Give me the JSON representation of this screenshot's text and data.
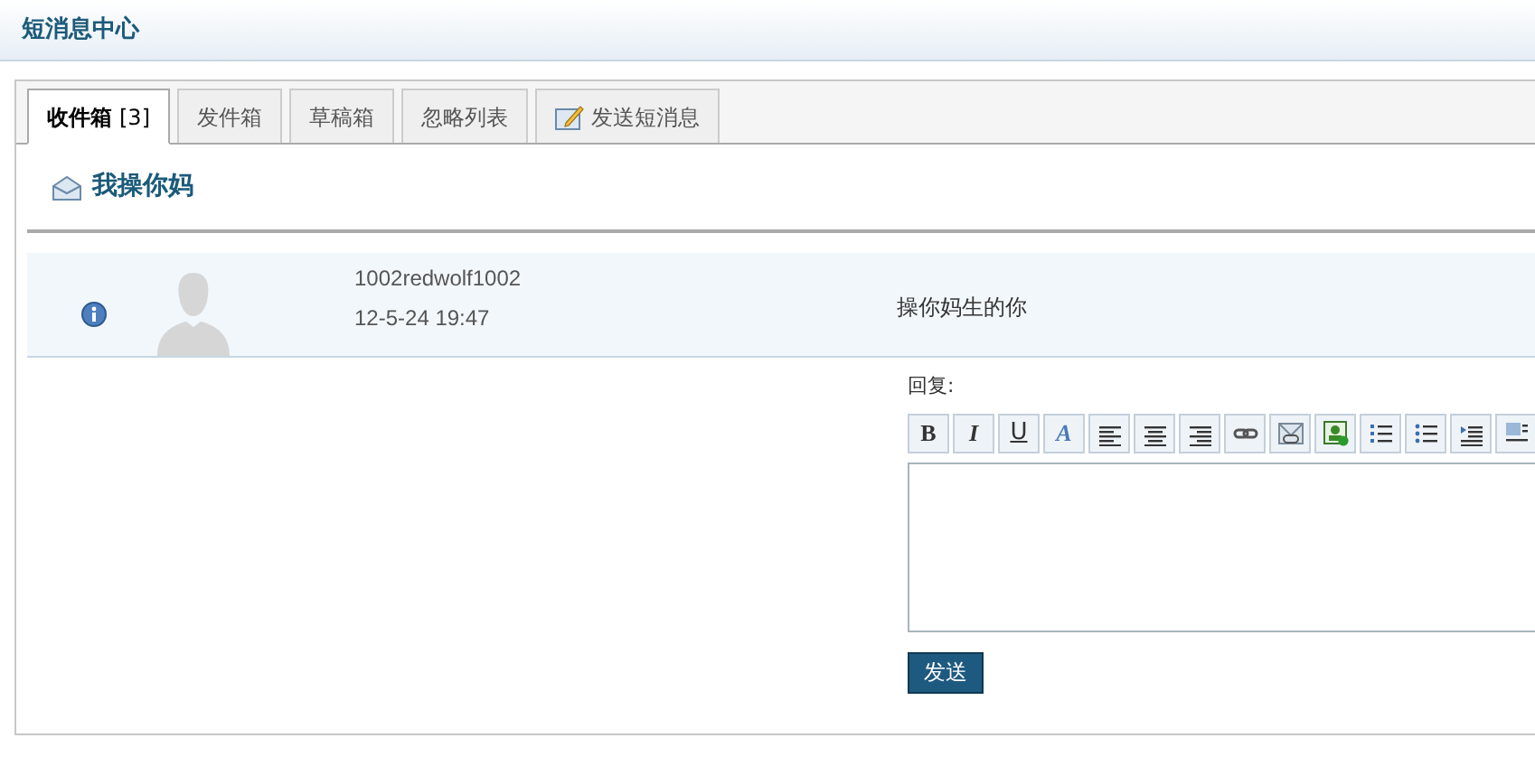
{
  "header": {
    "title": "短消息中心"
  },
  "tabs": [
    {
      "label": "收件箱",
      "count": "[3]",
      "selected": true,
      "kind": "plain"
    },
    {
      "label": "发件箱",
      "selected": false,
      "kind": "plain"
    },
    {
      "label": "草稿箱",
      "selected": false,
      "kind": "plain"
    },
    {
      "label": "忽略列表",
      "selected": false,
      "kind": "plain"
    },
    {
      "label": "发送短消息",
      "selected": false,
      "kind": "compose"
    }
  ],
  "thread": {
    "subject": "我操你妈"
  },
  "message": {
    "sender": "1002redwolf1002",
    "time": "12-5-24 19:47",
    "text": "操你妈生的你"
  },
  "reply": {
    "label": "回复:",
    "toolbar": [
      {
        "kind": "bold",
        "label": "B"
      },
      {
        "kind": "italic",
        "label": "I"
      },
      {
        "kind": "underline",
        "label": "U"
      },
      {
        "kind": "font",
        "label": "A"
      },
      {
        "kind": "align-left"
      },
      {
        "kind": "align-center"
      },
      {
        "kind": "align-right"
      },
      {
        "kind": "link"
      },
      {
        "kind": "unlink"
      },
      {
        "kind": "image"
      },
      {
        "kind": "ordered-list"
      },
      {
        "kind": "bullet-list"
      },
      {
        "kind": "indent"
      },
      {
        "kind": "block"
      }
    ],
    "send": "发送"
  }
}
